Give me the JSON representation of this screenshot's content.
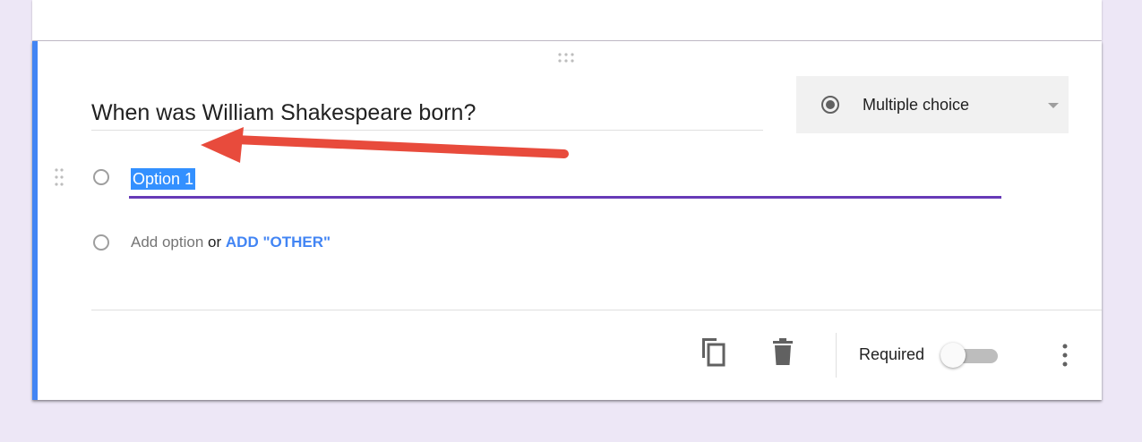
{
  "question": {
    "title": "When was William Shakespeare born?",
    "type_label": "Multiple choice",
    "options": [
      {
        "label": "Option 1",
        "selected_text": true
      }
    ],
    "add_option_label": "Add option",
    "or_label": "or",
    "add_other_label": "ADD \"OTHER\""
  },
  "footer": {
    "required_label": "Required",
    "required_on": false
  },
  "icons": {
    "drag_handle": "drag-handle-icon",
    "type": "radio-checked-icon",
    "copy": "copy-icon",
    "delete": "trash-icon",
    "more": "more-vert-icon",
    "annotation": "red-arrow"
  },
  "colors": {
    "accent": "#4285f4",
    "focus_underline": "#673ab7",
    "selection": "#3390ff",
    "annotation_arrow": "#e84b3c",
    "background": "#ede7f6"
  }
}
